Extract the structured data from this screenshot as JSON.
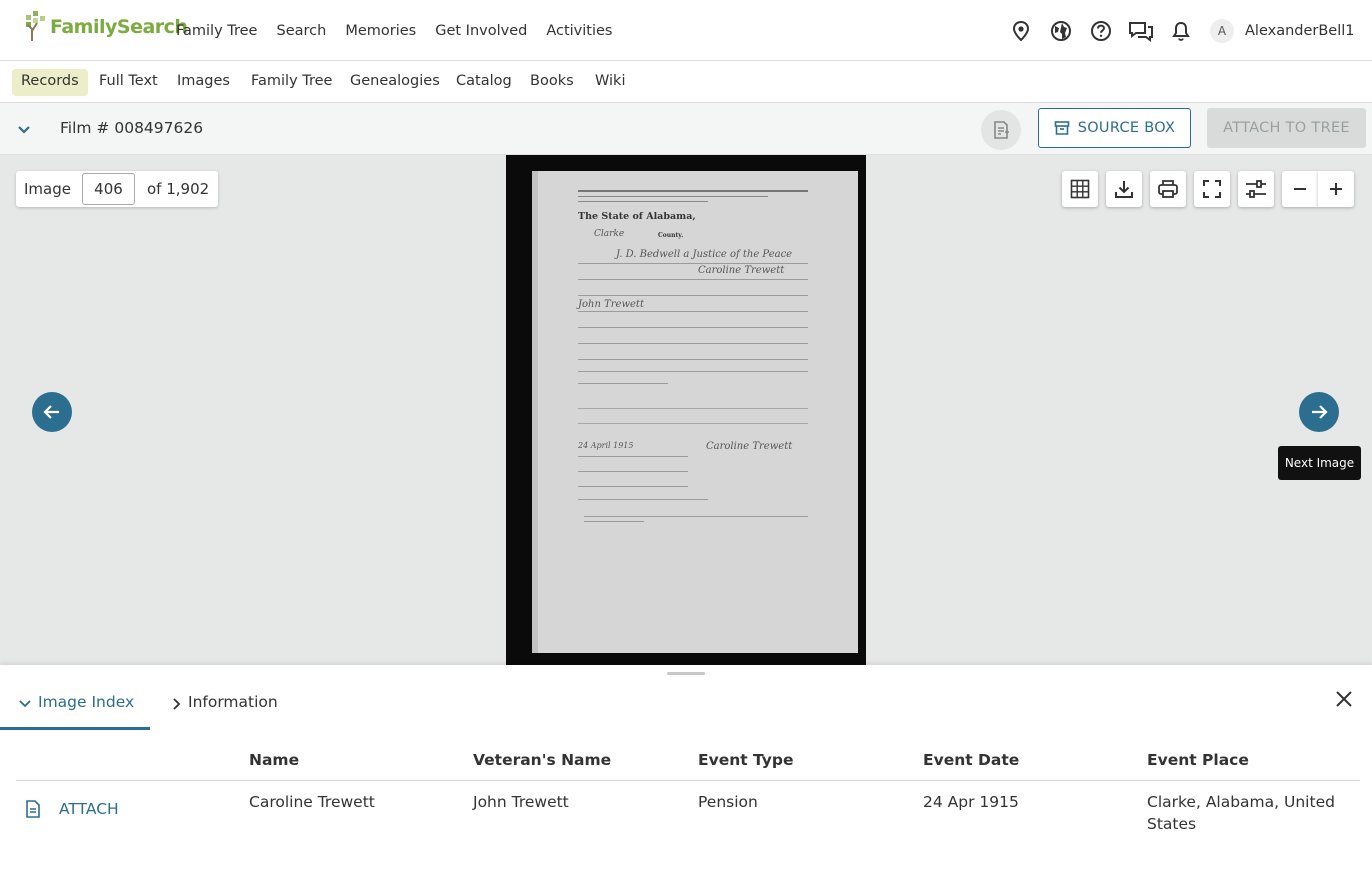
{
  "header": {
    "logo_text": "FamilySearch",
    "nav": [
      "Family Tree",
      "Search",
      "Memories",
      "Get Involved",
      "Activities"
    ],
    "icons": [
      "location-pin-icon",
      "globe-icon",
      "help-icon",
      "chat-icon",
      "bell-icon"
    ],
    "avatar_initial": "A",
    "username": "AlexanderBell1"
  },
  "subnav": {
    "items": [
      "Records",
      "Full Text",
      "Images",
      "Family Tree",
      "Genealogies",
      "Catalog",
      "Books",
      "Wiki"
    ],
    "active": "Records"
  },
  "filmbar": {
    "title": "Film # 008497626",
    "source_box_label": "SOURCE BOX",
    "attach_label": "ATTACH TO TREE"
  },
  "viewer": {
    "image_label": "Image",
    "image_number": "406",
    "of_total": "of 1,902",
    "tooltip": "Next Image"
  },
  "document": {
    "heading": "The State of Alabama,",
    "county_label": "County.",
    "county_hand": "Clarke",
    "justice_hand": "J. D. Bedwell a Justice of the Peace",
    "name_hand": "Caroline Trewett",
    "veteran_hand": "John Trewett",
    "date_hand": "24 April 1915"
  },
  "panel": {
    "tabs": [
      "Image Index",
      "Information"
    ],
    "columns": [
      "Name",
      "Veteran's Name",
      "Event Type",
      "Event Date",
      "Event Place"
    ],
    "attach_label": "ATTACH",
    "row": {
      "name": "Caroline Trewett",
      "veteran": "John Trewett",
      "event_type": "Pension",
      "event_date": "24 Apr 1915",
      "event_place_line1": "Clarke, Alabama, United",
      "event_place_line2": "States"
    }
  },
  "colors": {
    "brand_green": "#7bac3f",
    "accent_blue": "#2c6e8f",
    "active_subnav": "#eceec9"
  }
}
